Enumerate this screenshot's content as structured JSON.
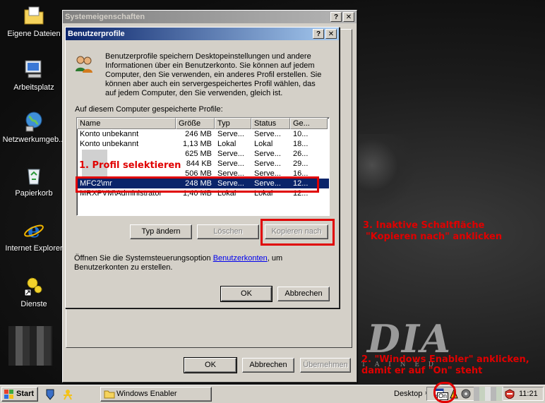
{
  "desktop": {
    "icons": [
      {
        "label": "Eigene Dateien"
      },
      {
        "label": "Arbeitsplatz"
      },
      {
        "label": "Netzwerkumgeb..."
      },
      {
        "label": "Papierkorb"
      },
      {
        "label": "Internet Explorer"
      },
      {
        "label": "Dienste"
      }
    ],
    "wallpaper_text": "DIA",
    "wallpaper_subtext": "T A I N E D"
  },
  "sysprops": {
    "title": "Systemeigenschaften",
    "ok": "OK",
    "cancel": "Abbrechen",
    "apply": "Übernehmen"
  },
  "profiles": {
    "title": "Benutzerprofile",
    "description": "Benutzerprofile speichern Desktopeinstellungen und andere Informationen über ein Benutzerkonto. Sie können auf jedem Computer, den Sie verwenden, ein anderes Profil erstellen. Sie können aber auch ein servergespeichertes Profil wählen, das auf jedem Computer, den Sie verwenden, gleich ist.",
    "list_label": "Auf diesem Computer gespeicherte Profile:",
    "columns": [
      "Name",
      "Größe",
      "Typ",
      "Status",
      "Ge..."
    ],
    "rows": [
      {
        "name": "Konto unbekannt",
        "size": "246 MB",
        "type": "Serve...",
        "status": "Serve...",
        "ge": "10..."
      },
      {
        "name": "Konto unbekannt",
        "size": "1,13 MB",
        "type": "Lokal",
        "status": "Lokal",
        "ge": "18..."
      },
      {
        "name": "",
        "size": "625 MB",
        "type": "Serve...",
        "status": "Serve...",
        "ge": "26..."
      },
      {
        "name": "",
        "size": "844 KB",
        "type": "Serve...",
        "status": "Serve...",
        "ge": "29..."
      },
      {
        "name": "",
        "size": "506 MB",
        "type": "Serve...",
        "status": "Serve...",
        "ge": "16..."
      },
      {
        "name": "MFC2\\mr",
        "size": "248 MB",
        "type": "Serve...",
        "status": "Serve...",
        "ge": "12..."
      },
      {
        "name": "MRXPVM\\Administrator",
        "size": "1,40 MB",
        "type": "Lokal",
        "status": "Lokal",
        "ge": "12..."
      }
    ],
    "selected_row": 5,
    "btn_change_type": "Typ ändern",
    "btn_delete": "Löschen",
    "btn_copy_to": "Kopieren nach",
    "footer_text_pre": "Öffnen Sie die Systemsteuerungsoption ",
    "footer_link": "Benutzerkonten",
    "footer_text_post": ", um Benutzerkonten zu erstellen.",
    "ok": "OK",
    "cancel": "Abbrechen"
  },
  "annotations": {
    "step1": "1. Profil selektieren",
    "step3_line1": "3. Inaktive Schaltfläche",
    "step3_line2": "\"Kopieren nach\" anklicken",
    "step2_line1": "2. \"Windows Enabler\" anklicken,",
    "step2_line2": "damit er auf \"On\" steht",
    "accent_color": "#e00000"
  },
  "taskbar": {
    "start": "Start",
    "task": "Windows Enabler",
    "desktop_label": "Desktop",
    "tray_badge": "On",
    "clock": "11:21"
  }
}
